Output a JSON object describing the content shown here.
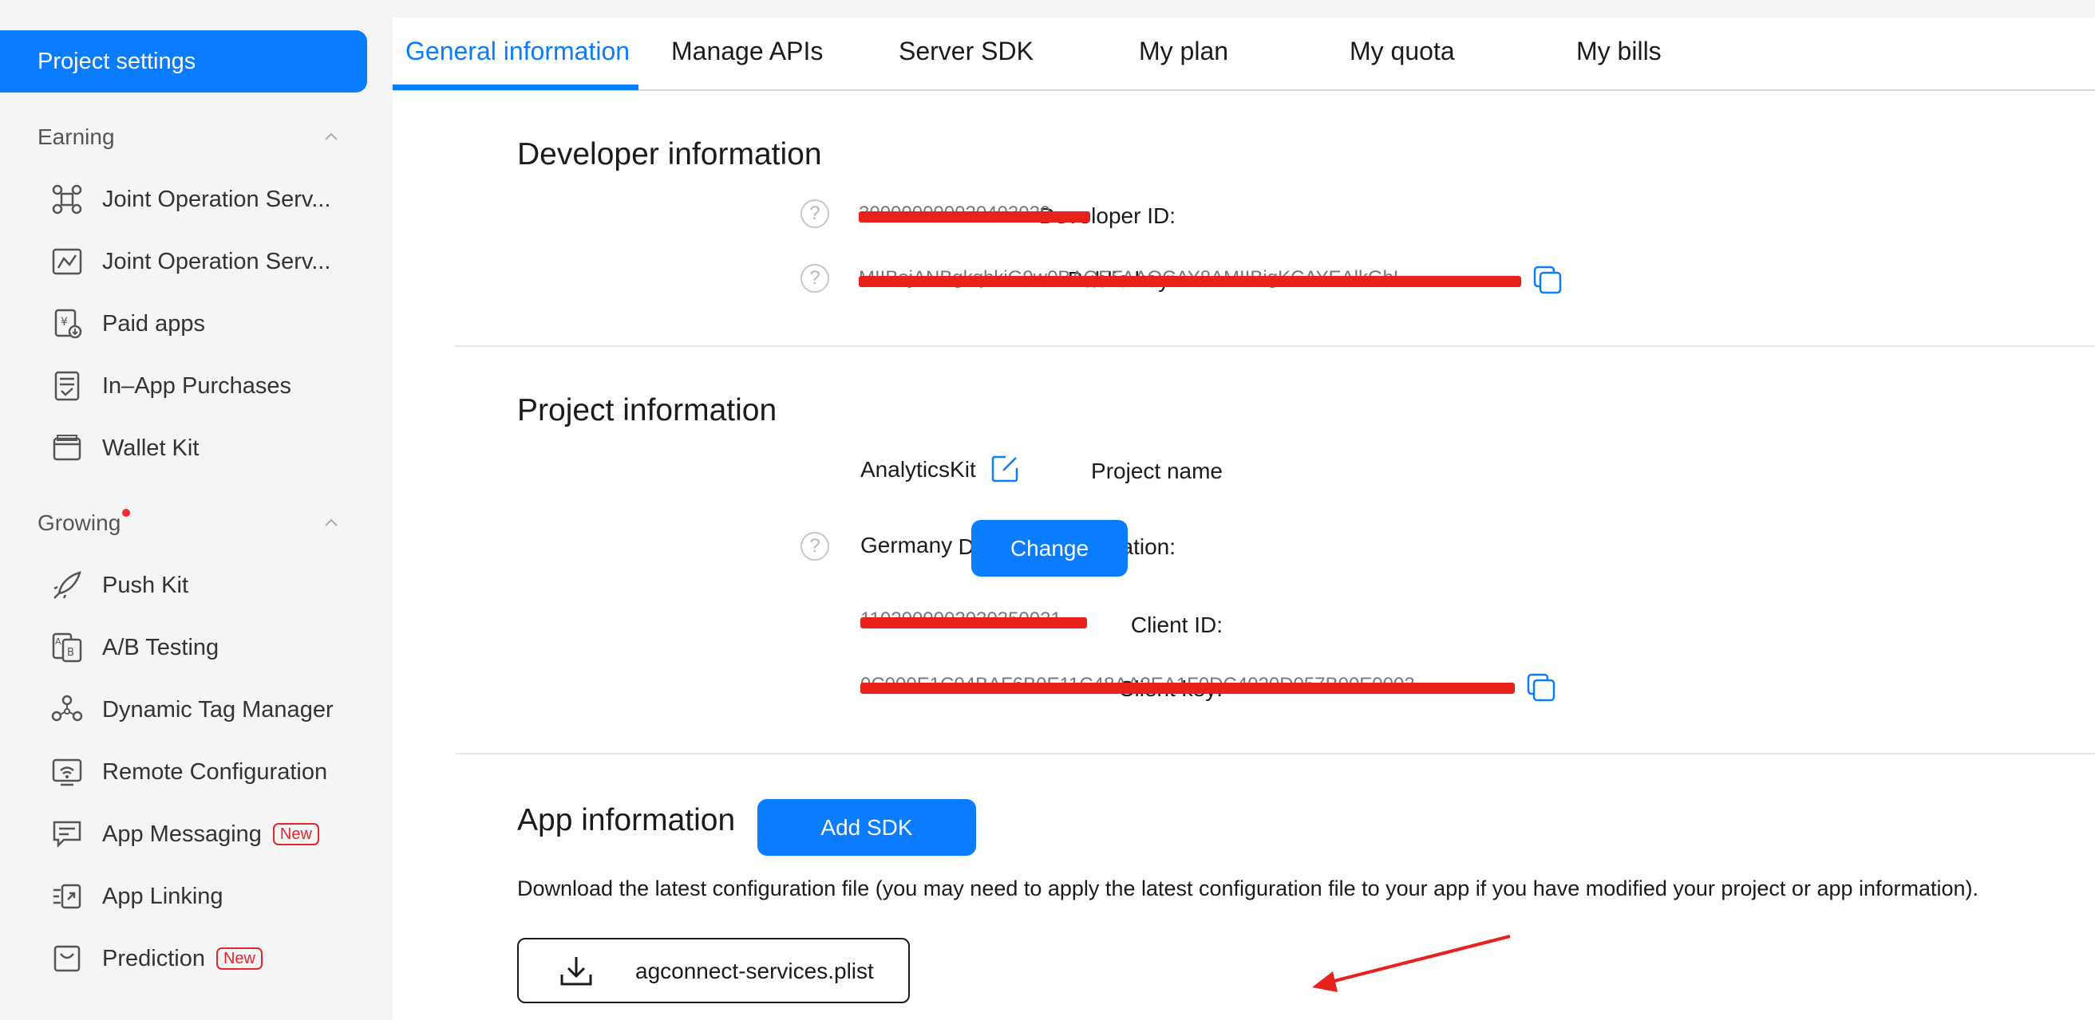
{
  "sidebar": {
    "active_item": "Project settings",
    "sections": [
      {
        "title": "Earning",
        "has_dot": false,
        "items": [
          {
            "label": "Joint Operation Serv...",
            "icon": "joint-operation-icon"
          },
          {
            "label": "Joint Operation Serv...",
            "icon": "joint-operation-chart-icon"
          },
          {
            "label": "Paid apps",
            "icon": "paid-apps-icon"
          },
          {
            "label": "In–App Purchases",
            "icon": "in-app-purchases-icon"
          },
          {
            "label": "Wallet Kit",
            "icon": "wallet-icon"
          }
        ]
      },
      {
        "title": "Growing",
        "has_dot": true,
        "items": [
          {
            "label": "Push Kit",
            "icon": "rocket-icon"
          },
          {
            "label": "A/B Testing",
            "icon": "ab-testing-icon"
          },
          {
            "label": "Dynamic Tag Manager",
            "icon": "tag-manager-icon"
          },
          {
            "label": "Remote Configuration",
            "icon": "remote-config-icon"
          },
          {
            "label": "App Messaging",
            "icon": "app-messaging-icon",
            "badge": "New"
          },
          {
            "label": "App Linking",
            "icon": "app-linking-icon"
          },
          {
            "label": "Prediction",
            "icon": "prediction-icon",
            "badge": "New"
          }
        ]
      }
    ]
  },
  "tabs": [
    "General information",
    "Manage APIs",
    "Server SDK",
    "My plan",
    "My quota",
    "My bills"
  ],
  "active_tab": "General information",
  "developer": {
    "title": "Developer information",
    "developer_id_label": "Developer ID:",
    "developer_id_value": "300000000020403020",
    "public_key_label": "Public key:",
    "public_key_value": "MIIBojANBgkqhkiG9w0BAQEFAAOCAY8AMIIBigKCAYEAlkGbL..."
  },
  "project": {
    "title": "Project information",
    "name_label": "Project name",
    "name_value": "AnalyticsKit",
    "storage_label": "Data storage location:",
    "storage_value": "Germany",
    "change_button": "Change",
    "client_id_label": "Client ID:",
    "client_id_value": "1102000002020350021",
    "client_key_label": "Client key:",
    "client_key_value": "0C000E1C04BAF6B0E11C48AA2EA1F0DC4020D057B00E0003..."
  },
  "app": {
    "title": "App information",
    "add_sdk_button": "Add SDK",
    "description": "Download the latest configuration file (you may need to apply the latest configuration file to your app if you have modified your project or app information).",
    "file_name": "agconnect-services.plist"
  },
  "colors": {
    "accent": "#0a7cff",
    "redaction": "#e8221b",
    "badge": "#e8242c"
  }
}
